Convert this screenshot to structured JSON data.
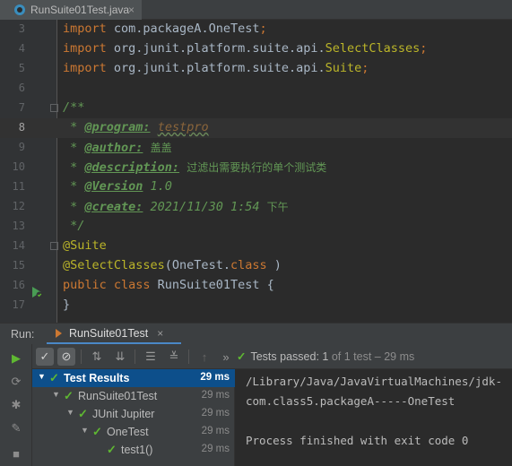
{
  "editor_tab": {
    "filename": "RunSuite01Test.java",
    "close": "×"
  },
  "code_lines": [
    {
      "num": "3",
      "parts": [
        [
          "kw",
          "import "
        ],
        [
          "plain",
          "com.packageA.OneTest"
        ],
        [
          "kw",
          ";"
        ]
      ]
    },
    {
      "num": "4",
      "parts": [
        [
          "kw",
          "import "
        ],
        [
          "plain",
          "org.junit.platform.suite.api."
        ],
        [
          "ann",
          "SelectClasses"
        ],
        [
          "kw",
          ";"
        ]
      ]
    },
    {
      "num": "5",
      "parts": [
        [
          "kw",
          "import "
        ],
        [
          "plain",
          "org.junit.platform.suite.api."
        ],
        [
          "ann",
          "Suite"
        ],
        [
          "kw",
          ";"
        ]
      ]
    },
    {
      "num": "6",
      "parts": []
    },
    {
      "num": "7",
      "parts": [
        [
          "doc",
          "/**"
        ]
      ]
    },
    {
      "num": "8",
      "parts": [
        [
          "doc",
          " * "
        ],
        [
          "doctag",
          "@program:"
        ],
        [
          "doc",
          " "
        ],
        [
          "docval",
          "testpro"
        ]
      ]
    },
    {
      "num": "9",
      "parts": [
        [
          "doc",
          " * "
        ],
        [
          "doctag",
          "@author:"
        ],
        [
          "doc",
          " "
        ],
        [
          "cjk",
          "盖盖"
        ]
      ]
    },
    {
      "num": "10",
      "parts": [
        [
          "doc",
          " * "
        ],
        [
          "doctag",
          "@description:"
        ],
        [
          "doc",
          " "
        ],
        [
          "cjk",
          "过滤出需要执行的单个测试类"
        ]
      ]
    },
    {
      "num": "11",
      "parts": [
        [
          "doc",
          " * "
        ],
        [
          "doctag",
          "@Version"
        ],
        [
          "doc",
          " 1.0"
        ]
      ]
    },
    {
      "num": "12",
      "parts": [
        [
          "doc",
          " * "
        ],
        [
          "doctag",
          "@create:"
        ],
        [
          "doc",
          " 2021/11/30 1:54 "
        ],
        [
          "cjk",
          "下午"
        ]
      ]
    },
    {
      "num": "13",
      "parts": [
        [
          "doc",
          " */"
        ]
      ]
    },
    {
      "num": "14",
      "parts": [
        [
          "ann",
          "@Suite"
        ]
      ]
    },
    {
      "num": "15",
      "parts": [
        [
          "ann",
          "@SelectClasses"
        ],
        [
          "plain",
          "(OneTest."
        ],
        [
          "kw",
          "class"
        ],
        [
          "plain",
          " )"
        ]
      ]
    },
    {
      "num": "16",
      "parts": [
        [
          "kw",
          "public class "
        ],
        [
          "plain",
          "RunSuite01Test {"
        ]
      ]
    },
    {
      "num": "17",
      "parts": [
        [
          "plain",
          "}"
        ]
      ]
    }
  ],
  "current_line": "8",
  "run_panel": {
    "label": "Run:",
    "tab_title": "RunSuite01Test",
    "tab_close": "×",
    "status_passed": "Tests passed:",
    "status_count": "1",
    "status_rest": "of 1 test – 29 ms"
  },
  "test_tree": [
    {
      "name": "Test Results",
      "time": "29 ms",
      "depth": 0,
      "selected": true
    },
    {
      "name": "RunSuite01Test",
      "time": "29 ms",
      "depth": 1,
      "selected": false
    },
    {
      "name": "JUnit Jupiter",
      "time": "29 ms",
      "depth": 2,
      "selected": false
    },
    {
      "name": "OneTest",
      "time": "29 ms",
      "depth": 3,
      "selected": false
    },
    {
      "name": "test1()",
      "time": "29 ms",
      "depth": 4,
      "selected": false
    }
  ],
  "console_lines": [
    "/Library/Java/JavaVirtualMachines/jdk-",
    "com.class5.packageA-----OneTest",
    "",
    "Process finished with exit code 0"
  ],
  "colors": {
    "pass_green": "#5fb832",
    "selection_blue": "#0d4f8b",
    "keyword_orange": "#cc7832",
    "annotation_yellow": "#bbb529",
    "doc_green": "#629755"
  },
  "icons": {
    "rerun": "play-icon",
    "show_passed": "check-icon",
    "show_ignored": "cancel-circle-icon",
    "sort_alpha": "sort-alpha-icon",
    "sort_duration": "sort-duration-icon",
    "expand_all": "expand-all-icon",
    "collapse_all": "collapse-all-icon",
    "prev_failed": "arrow-up-icon",
    "more": "more-icon"
  }
}
